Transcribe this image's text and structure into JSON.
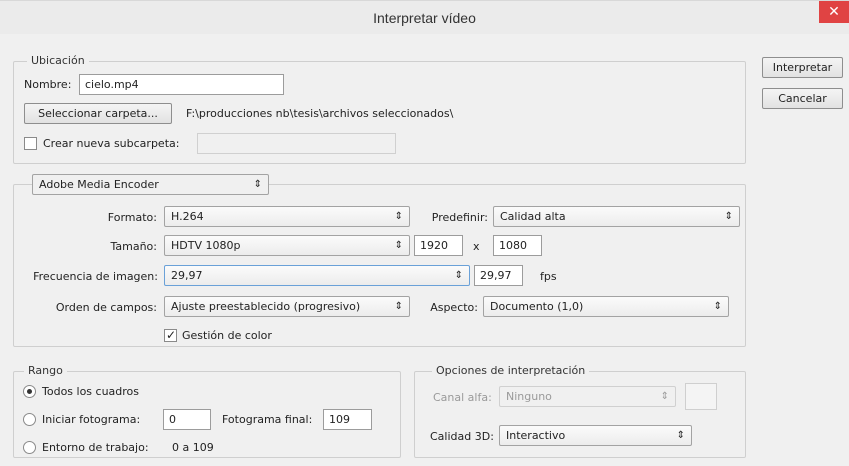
{
  "window": {
    "title": "Interpretar vídeo",
    "close_glyph": "✕"
  },
  "buttons": {
    "interpretar": "Interpretar",
    "cancelar": "Cancelar"
  },
  "ubicacion": {
    "legend": "Ubicación",
    "nombre_label": "Nombre:",
    "nombre_value": "cielo.mp4",
    "select_folder_button": "Seleccionar carpeta...",
    "path": "F:\\producciones nb\\tesis\\archivos seleccionados\\",
    "subfolder_label": "Crear nueva subcarpeta:",
    "subfolder_checked": false,
    "subfolder_value": ""
  },
  "encoder": {
    "selected": "Adobe Media Encoder",
    "formato_label": "Formato:",
    "formato_value": "H.264",
    "predefinir_label": "Predefinir:",
    "predefinir_value": "Calidad alta",
    "tamano_label": "Tamaño:",
    "tamano_value": "HDTV 1080p",
    "width": "1920",
    "x_sep": "x",
    "height": "1080",
    "frecuencia_label": "Frecuencia de imagen:",
    "frecuencia_value": "29,97",
    "fps_value": "29,97",
    "fps_label": "fps",
    "orden_label": "Orden de campos:",
    "orden_value": "Ajuste preestablecido (progresivo)",
    "aspecto_label": "Aspecto:",
    "aspecto_value": "Documento (1,0)",
    "gestion_color_label": "Gestión de color",
    "gestion_color_checked": true
  },
  "rango": {
    "legend": "Rango",
    "todos_label": "Todos los cuadros",
    "iniciar_label": "Iniciar fotograma:",
    "iniciar_value": "0",
    "final_label": "Fotograma final:",
    "final_value": "109",
    "entorno_label": "Entorno de trabajo:",
    "entorno_value": "0 a 109",
    "selected": "todos"
  },
  "opciones": {
    "legend": "Opciones de interpretación",
    "canal_label": "Canal alfa:",
    "canal_value": "Ninguno",
    "calidad_label": "Calidad 3D:",
    "calidad_value": "Interactivo"
  },
  "icons": {
    "select_arrow": "⇕",
    "check": "✓"
  }
}
